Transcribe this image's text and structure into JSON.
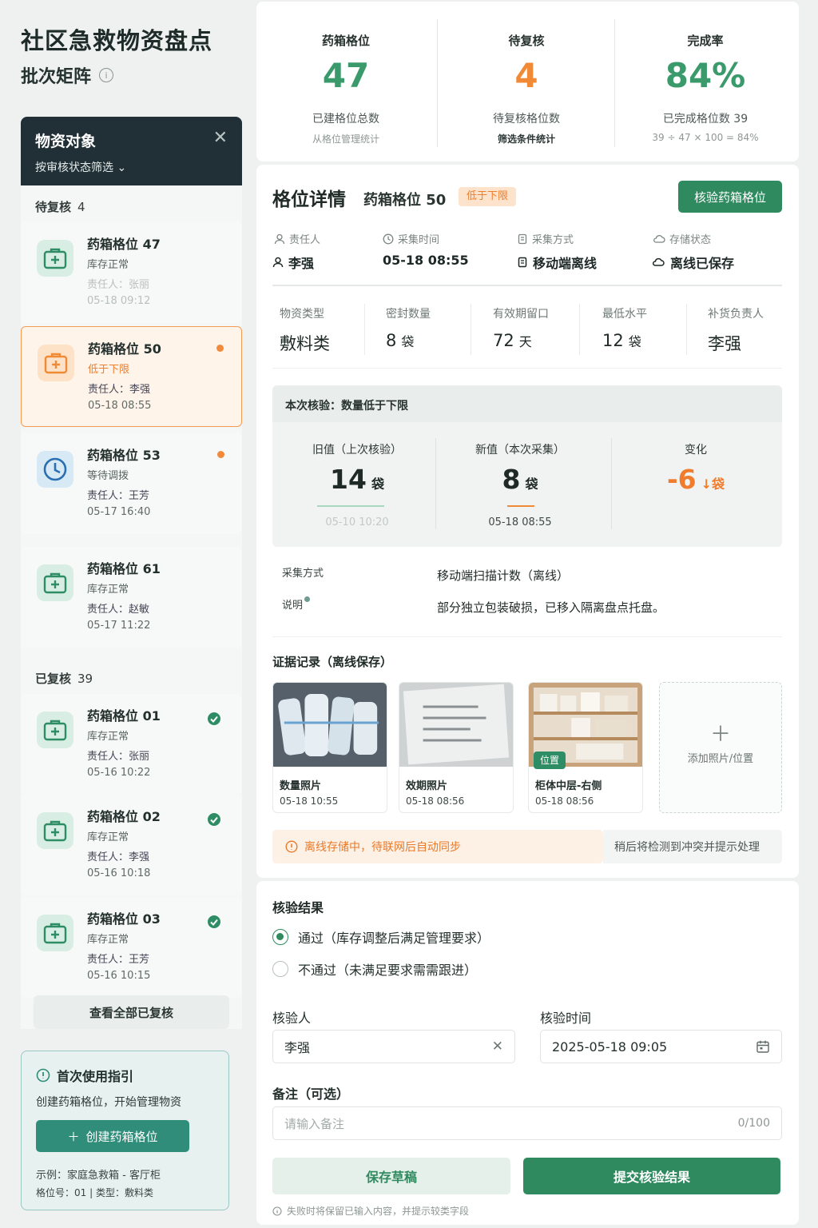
{
  "app": {
    "title": "社区急救物资盘点",
    "subtitle": "批次矩阵",
    "info_icon": "info-circle-icon"
  },
  "filter": {
    "title": "物资对象",
    "dropdown_label": "按审核状态筛选",
    "close_icon": "close-icon"
  },
  "groups": {
    "pending": {
      "label": "待复核",
      "count": "4"
    },
    "done": {
      "label": "已复核",
      "count": "39"
    }
  },
  "pending_items": [
    {
      "name": "药箱格位 47",
      "status": "库存正常",
      "owner": "责任人：张丽",
      "time": "05-18 09:12",
      "icon": "medkit-icon"
    },
    {
      "name": "药箱格位 50",
      "status": "低于下限",
      "owner": "责任人：李强",
      "time": "05-18 08:55",
      "icon": "medkit-icon"
    },
    {
      "name": "药箱格位 53",
      "status": "等待调拨",
      "owner": "责任人：王芳",
      "time": "05-17 16:40",
      "icon": "clock-icon"
    },
    {
      "name": "药箱格位 61",
      "status": "库存正常",
      "owner": "责任人：赵敏",
      "time": "05-17 11:22",
      "icon": "medkit-icon"
    }
  ],
  "done_items": [
    {
      "name": "药箱格位 01",
      "status": "库存正常",
      "owner": "责任人：张丽",
      "time": "05-16 10:22",
      "icon": "medkit-icon"
    },
    {
      "name": "药箱格位 02",
      "status": "库存正常",
      "owner": "责任人：李强",
      "time": "05-16 10:18",
      "icon": "medkit-icon"
    },
    {
      "name": "药箱格位 03",
      "status": "库存正常",
      "owner": "责任人：王芳",
      "time": "05-16 10:15",
      "icon": "medkit-icon"
    }
  ],
  "view_all_label": "查看全部已复核",
  "guide": {
    "title": "首次使用指引",
    "desc": "创建药箱格位，开始管理物资",
    "button": "创建药箱格位",
    "example1": "示例：家庭急救箱 - 客厅柜",
    "example2": "格位号：01 | 类型：敷料类"
  },
  "stats": [
    {
      "label": "药箱格位",
      "value": "47",
      "desc": "已建格位总数",
      "note": "从格位管理统计",
      "color": "#3a9a6b"
    },
    {
      "label": "待复核",
      "value": "4",
      "desc": "待复核格位数",
      "note": "筛选条件统计",
      "color": "#f08a36"
    },
    {
      "label": "完成率",
      "value": "84%",
      "desc": "已完成格位数 39",
      "note": "39 ÷ 47 × 100 = 84%",
      "color": "#3a9a6b"
    }
  ],
  "detail": {
    "title": "格位详情",
    "slot": "药箱格位 50",
    "tag": "低于下限",
    "verify_button": "核验药箱格位",
    "meta": [
      {
        "label": "责任人",
        "value": "李强",
        "icon": "user-icon"
      },
      {
        "label": "采集时间",
        "value": "05-18 08:55",
        "icon": "clock-icon"
      },
      {
        "label": "采集方式",
        "value": "移动端离线",
        "icon": "device-icon"
      },
      {
        "label": "存储状态",
        "value": "离线已保存",
        "icon": "cloud-icon"
      }
    ],
    "attrs": [
      {
        "label": "物资类型",
        "value": "敷料类",
        "unit": ""
      },
      {
        "label": "密封数量",
        "value": "8",
        "unit": "袋"
      },
      {
        "label": "有效期留口",
        "value": "72",
        "unit": "天"
      },
      {
        "label": "最低水平",
        "value": "12",
        "unit": "袋"
      },
      {
        "label": "补货负责人",
        "value": "李强",
        "unit": ""
      }
    ],
    "compare": {
      "title": "本次核验：数量低于下限",
      "old_label": "旧值（上次核验）",
      "old_value": "14",
      "old_unit": "袋",
      "old_time": "05-10 10:20",
      "new_label": "新值（本次采集）",
      "new_value": "8",
      "new_unit": "袋",
      "new_time": "05-18 08:55",
      "change_label": "变化",
      "change_value": "-6",
      "change_unit": "袋"
    },
    "method_label": "采集方式",
    "method_value": "移动端扫描计数（离线）",
    "note_label": "说明",
    "note_value": "部分独立包装破损，已移入隔离盘点托盘。",
    "evidence_title": "证据记录（离线保存）",
    "evidence": [
      {
        "label": "数量照片",
        "time": "05-18 10:55"
      },
      {
        "label": "效期照片",
        "time": "05-18 08:56"
      },
      {
        "label": "柜体中层-右侧",
        "time": "05-18 08:56",
        "badge": "位置"
      }
    ],
    "add_evidence": "添加照片/位置",
    "offline_msg": "离线存储中，待联网后自动同步",
    "conflict_msg": "稍后将检测到冲突并提示处理"
  },
  "result": {
    "title": "核验结果",
    "pass_label": "通过（库存调整后满足管理要求）",
    "fail_label": "不通过（未满足要求需需跟进）",
    "checker_label": "核验人",
    "checker_value": "李强",
    "time_label": "核验时间",
    "time_value": "2025-05-18 09:05",
    "note_label": "备注（可选）",
    "note_placeholder": "请输入备注",
    "note_count": "0/100",
    "draft_button": "保存草稿",
    "submit_button": "提交核验结果",
    "footnote": "失败时将保留已输入内容，并提示较类字段"
  }
}
